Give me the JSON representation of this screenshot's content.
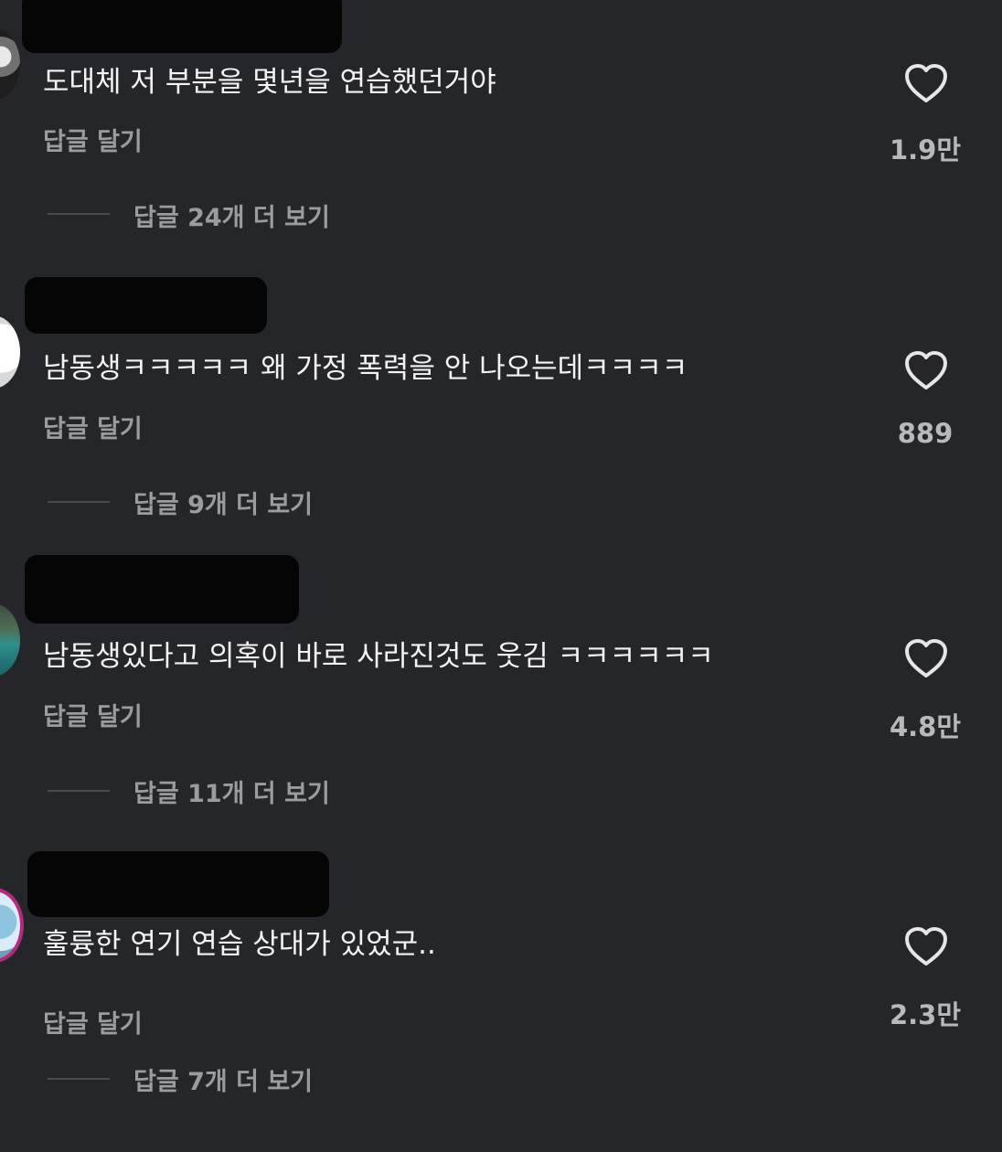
{
  "comments": [
    {
      "text": "도대체 저 부분을 몇년을 연습했던거야",
      "reply_label": "답글 달기",
      "likes": "1.9만",
      "more_replies": "답글 24개 더 보기"
    },
    {
      "text": "남동생ㅋㅋㅋㅋㅋ 왜 가정 폭력을 안 나오는데ㅋㅋㅋㅋ",
      "reply_label": "답글 달기",
      "likes": "889",
      "more_replies": "답글 9개 더 보기"
    },
    {
      "text": "남동생있다고 의혹이 바로 사라진것도 웃김 ㅋㅋㅋㅋㅋㅋ",
      "reply_label": "답글 달기",
      "likes": "4.8만",
      "more_replies": "답글 11개 더 보기"
    },
    {
      "text": "훌륭한 연기 연습 상대가 있었군..",
      "reply_label": "답글 달기",
      "likes": "2.3만",
      "more_replies": "답글 7개 더 보기"
    }
  ],
  "icons": {
    "like": "heart-outline-icon"
  },
  "colors": {
    "background": "#25262a",
    "text": "#f4f4f4",
    "secondary": "#9b9ca0"
  }
}
